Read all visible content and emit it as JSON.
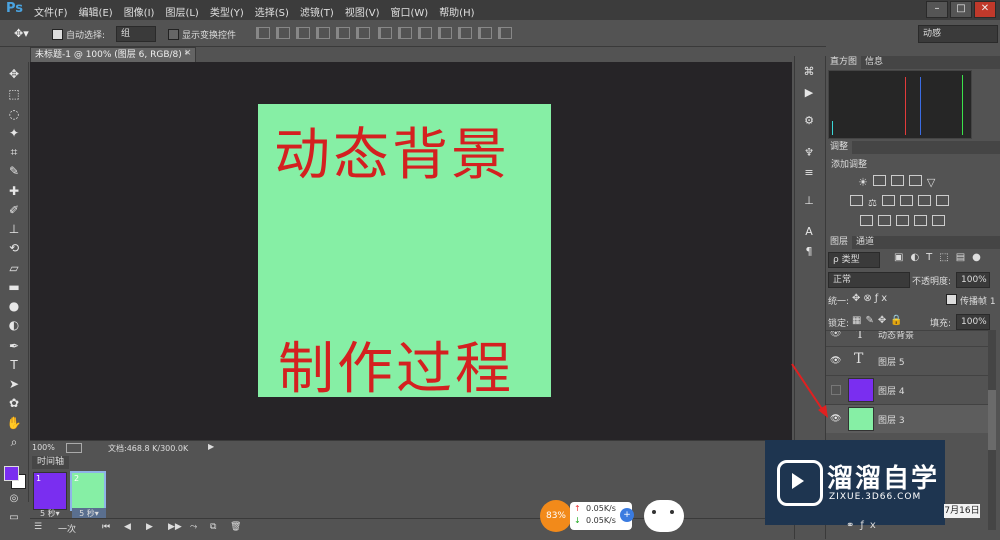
{
  "app": {
    "logo": "Ps"
  },
  "menu": [
    "文件(F)",
    "编辑(E)",
    "图像(I)",
    "图层(L)",
    "类型(Y)",
    "选择(S)",
    "滤镜(T)",
    "视图(V)",
    "窗口(W)",
    "帮助(H)"
  ],
  "window_controls": {
    "minimize": "–",
    "restore": "□",
    "close": "✕"
  },
  "options": {
    "auto_select_label": "自动选择:",
    "auto_select_value": "组",
    "show_transform_label": "显示变换控件",
    "workspace": "动感"
  },
  "doc_tab": "未标题-1 @ 100% (图层 6, RGB/8) *",
  "canvas": {
    "title_top": "动态背景",
    "title_bottom": "制作过程",
    "bg_color": "#86efa5",
    "text_color": "#d42020"
  },
  "status": {
    "zoom": "100%",
    "doc_info": "文档:468.8 K/300.0K"
  },
  "timeline": {
    "tab": "时间轴",
    "frames": [
      {
        "index": "1",
        "duration": "5 秒▾",
        "color": "#7a2ef0"
      },
      {
        "index": "2",
        "duration": "5 秒▾",
        "color": "#86efa5"
      }
    ],
    "loop": "一次"
  },
  "panels": {
    "histogram_tab": "直方图",
    "info_tab": "信息",
    "adjust_tab": "调整",
    "adjust_add": "添加调整",
    "layers_tab": "图层",
    "channels_tab": "通道",
    "filter_kind": "ρ 类型",
    "blend_mode": "正常",
    "opacity_label": "不透明度:",
    "opacity_value": "100%",
    "unify_label": "统一:",
    "propagate_label": "传播帧 1",
    "lock_label": "锁定:",
    "fill_label": "填充:",
    "fill_value": "100%",
    "layers": [
      {
        "name": "动态背景",
        "type": "text",
        "visible": true
      },
      {
        "name": "图层 5",
        "type": "text",
        "visible": true
      },
      {
        "name": "图层 4",
        "type": "color",
        "color": "#7a2ef0",
        "visible": false
      },
      {
        "name": "图层 3",
        "type": "color",
        "color": "#86efa5",
        "visible": true
      }
    ]
  },
  "watermark": {
    "brand": "溜溜自学",
    "site": "ZIXUE.3D66.COM"
  },
  "speed_widget": {
    "percent": "83%",
    "up": "0.05K/s",
    "down": "0.05K/s"
  },
  "date_fragment": "7月16日"
}
